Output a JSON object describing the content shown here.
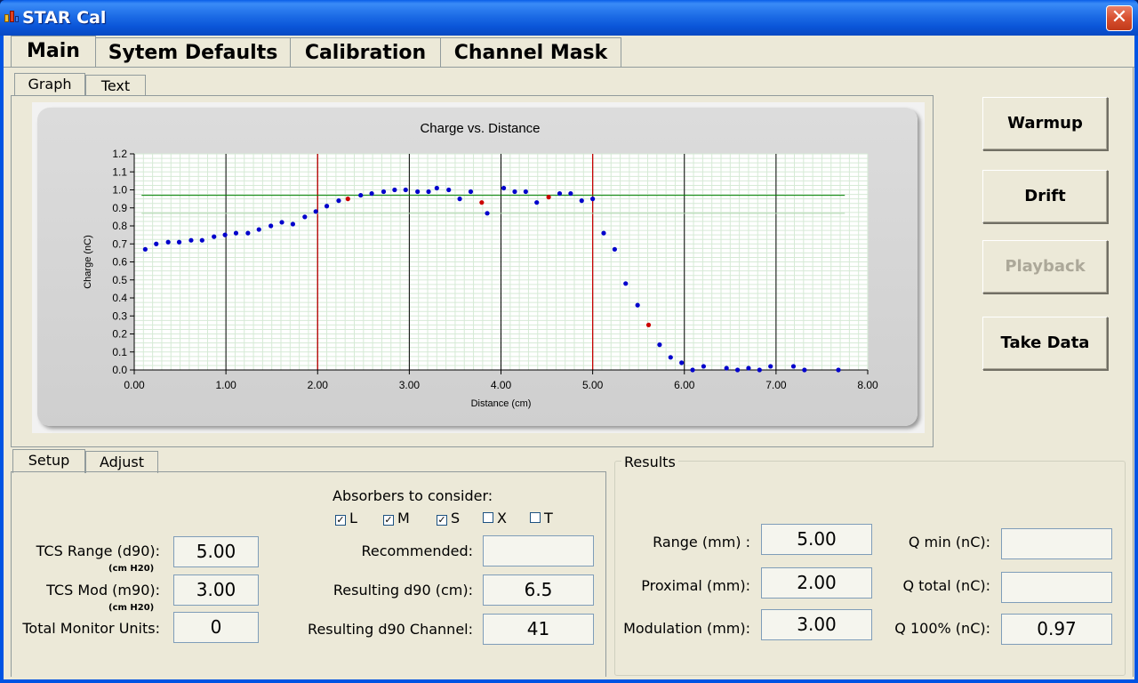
{
  "window": {
    "title": "STAR Cal",
    "close_glyph": "✕"
  },
  "main_tabs": [
    "Main",
    "Sytem Defaults",
    "Calibration",
    "Channel Mask"
  ],
  "view_tabs": [
    "Graph",
    "Text"
  ],
  "side_buttons": {
    "warmup": "Warmup",
    "drift": "Drift",
    "playback": "Playback",
    "take_data": "Take Data"
  },
  "setup_tabs": [
    "Setup",
    "Adjust"
  ],
  "setup": {
    "tcs_range_label": "TCS Range (d90):",
    "tcs_range_unit": "(cm H20)",
    "tcs_range_value": "5.00",
    "tcs_mod_label": "TCS Mod (m90):",
    "tcs_mod_unit": "(cm H20)",
    "tcs_mod_value": "3.00",
    "total_mu_label": "Total Monitor Units:",
    "total_mu_value": "0",
    "absorbers_label": "Absorbers to consider:",
    "absorbers": [
      {
        "label": "L",
        "checked": true
      },
      {
        "label": "M",
        "checked": true
      },
      {
        "label": "S",
        "checked": true
      },
      {
        "label": "X",
        "checked": false
      },
      {
        "label": "T",
        "checked": false
      }
    ],
    "recommended_label": "Recommended:",
    "recommended_value": "",
    "resulting_d90_label": "Resulting d90 (cm):",
    "resulting_d90_value": "6.5",
    "resulting_channel_label": "Resulting d90 Channel:",
    "resulting_channel_value": "41"
  },
  "results": {
    "legend": "Results",
    "range_label": "Range (mm) :",
    "range_value": "5.00",
    "proximal_label": "Proximal (mm):",
    "proximal_value": "2.00",
    "modulation_label": "Modulation (mm):",
    "modulation_value": "3.00",
    "qmin_label": "Q min (nC):",
    "qmin_value": "",
    "qtotal_label": "Q total (nC):",
    "qtotal_value": "",
    "q100_label": "Q 100% (nC):",
    "q100_value": "0.97"
  },
  "colors": {
    "titlebar": "#0054e3",
    "face": "#ece9d8",
    "point_blue": "#0000cc",
    "point_red": "#cc0000",
    "ref_green": "#008000",
    "vline_red": "#cc0000"
  },
  "chart_data": {
    "type": "scatter",
    "title": "Charge vs. Distance",
    "xlabel": "Distance (cm)",
    "ylabel": "Charge (nC)",
    "xlim": [
      0,
      8
    ],
    "ylim": [
      0,
      1.2
    ],
    "x_ticks": [
      "0.00",
      "1.00",
      "2.00",
      "3.00",
      "4.00",
      "5.00",
      "6.00",
      "7.00",
      "8.00"
    ],
    "y_ticks": [
      "0.0",
      "0.1",
      "0.2",
      "0.3",
      "0.4",
      "0.5",
      "0.6",
      "0.7",
      "0.8",
      "0.9",
      "1.0",
      "1.1",
      "1.2"
    ],
    "grid": true,
    "reference_lines": {
      "horizontal": [
        0.97,
        0.87
      ],
      "vertical_red": [
        2.0,
        5.0
      ]
    },
    "series": [
      {
        "color": "blue",
        "points": [
          [
            0.12,
            0.67
          ],
          [
            0.24,
            0.7
          ],
          [
            0.37,
            0.71
          ],
          [
            0.49,
            0.71
          ],
          [
            0.62,
            0.72
          ],
          [
            0.74,
            0.72
          ],
          [
            0.87,
            0.74
          ],
          [
            0.99,
            0.75
          ],
          [
            1.11,
            0.76
          ],
          [
            1.24,
            0.76
          ],
          [
            1.36,
            0.78
          ],
          [
            1.49,
            0.8
          ],
          [
            1.61,
            0.82
          ],
          [
            1.73,
            0.81
          ],
          [
            1.86,
            0.85
          ],
          [
            1.98,
            0.88
          ],
          [
            2.1,
            0.91
          ],
          [
            2.23,
            0.94
          ],
          [
            2.47,
            0.97
          ],
          [
            2.59,
            0.98
          ],
          [
            2.72,
            0.99
          ],
          [
            2.84,
            1.0
          ],
          [
            2.96,
            1.0
          ],
          [
            3.09,
            0.99
          ],
          [
            3.21,
            0.99
          ],
          [
            3.3,
            1.01
          ],
          [
            3.43,
            1.0
          ],
          [
            3.55,
            0.95
          ],
          [
            3.67,
            0.99
          ],
          [
            3.85,
            0.87
          ],
          [
            4.03,
            1.01
          ],
          [
            4.15,
            0.99
          ],
          [
            4.27,
            0.99
          ],
          [
            4.39,
            0.93
          ],
          [
            4.64,
            0.98
          ],
          [
            4.76,
            0.98
          ],
          [
            4.88,
            0.94
          ],
          [
            5.0,
            0.95
          ],
          [
            5.12,
            0.76
          ],
          [
            5.24,
            0.67
          ],
          [
            5.36,
            0.48
          ],
          [
            5.49,
            0.36
          ],
          [
            5.73,
            0.14
          ],
          [
            5.85,
            0.07
          ],
          [
            5.97,
            0.04
          ],
          [
            6.09,
            0.0
          ],
          [
            6.21,
            0.02
          ],
          [
            6.46,
            0.01
          ],
          [
            6.58,
            0.0
          ],
          [
            6.7,
            0.01
          ],
          [
            6.82,
            0.0
          ],
          [
            6.94,
            0.02
          ],
          [
            7.19,
            0.02
          ],
          [
            7.31,
            0.0
          ],
          [
            7.68,
            0.0
          ]
        ]
      },
      {
        "color": "red",
        "points": [
          [
            2.33,
            0.95
          ],
          [
            3.79,
            0.93
          ],
          [
            4.52,
            0.96
          ],
          [
            5.61,
            0.25
          ]
        ]
      }
    ]
  }
}
